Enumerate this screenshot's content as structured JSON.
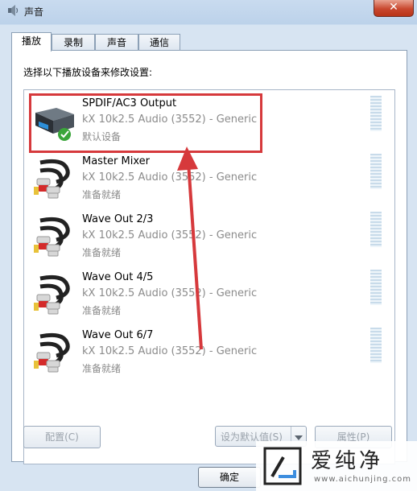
{
  "window": {
    "title": "声音",
    "close_symbol": "✕"
  },
  "tabs": [
    {
      "label": "播放",
      "active": true
    },
    {
      "label": "录制",
      "active": false
    },
    {
      "label": "声音",
      "active": false
    },
    {
      "label": "通信",
      "active": false
    }
  ],
  "instruction": "选择以下播放设备来修改设置:",
  "devices": [
    {
      "name": "SPDIF/AC3 Output",
      "driver": "kX 10k2.5 Audio (3552) - Generic",
      "status": "默认设备",
      "icon": "spdif-device-icon",
      "default": true,
      "highlighted": true
    },
    {
      "name": "Master Mixer",
      "driver": "kX 10k2.5 Audio (3552) - Generic",
      "status": "准备就绪",
      "icon": "rca-cable-icon"
    },
    {
      "name": "Wave Out 2/3",
      "driver": "kX 10k2.5 Audio (3552) - Generic",
      "status": "准备就绪",
      "icon": "rca-cable-icon"
    },
    {
      "name": "Wave Out 4/5",
      "driver": "kX 10k2.5 Audio (3552) - Generic",
      "status": "准备就绪",
      "icon": "rca-cable-icon"
    },
    {
      "name": "Wave Out 6/7",
      "driver": "kX 10k2.5 Audio (3552) - Generic",
      "status": "准备就绪",
      "icon": "rca-cable-icon"
    }
  ],
  "buttons": {
    "configure": "配置(C)",
    "set_default": "设为默认值(S)",
    "properties": "属性(P)",
    "ok": "确定"
  },
  "watermark": {
    "text": "爱纯净",
    "url": "www.aichunjing.com"
  },
  "colors": {
    "highlight": "#d6393c",
    "status_text": "#8b8b8b",
    "accent": "#3c8dde"
  }
}
